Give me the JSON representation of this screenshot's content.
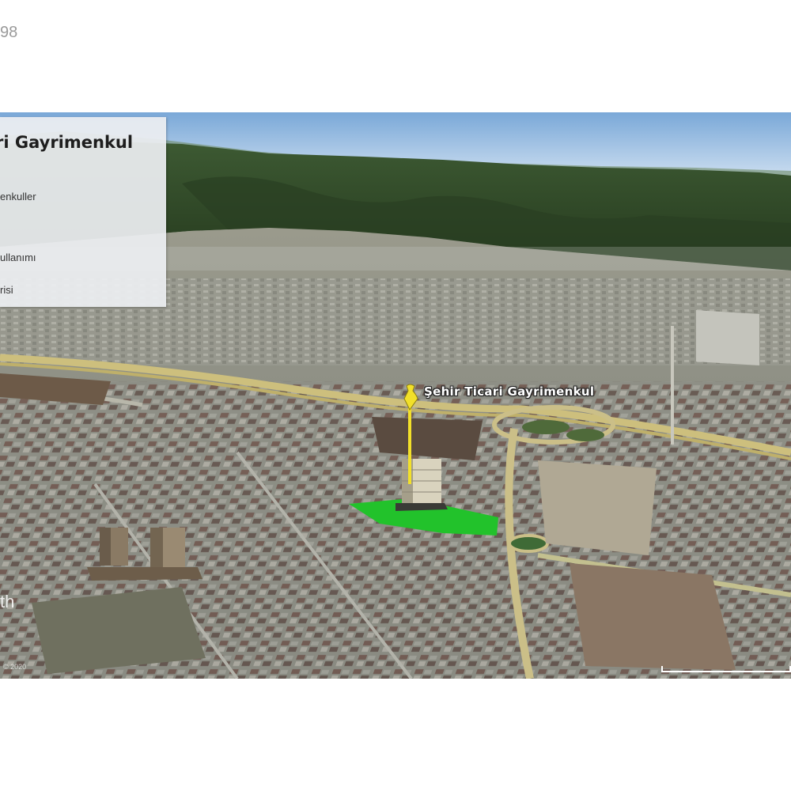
{
  "page": {
    "number": "98"
  },
  "legend": {
    "title": "ri Gayrimenkul",
    "items": [
      "enkuller",
      "ullanımı",
      "risi"
    ]
  },
  "map": {
    "placemark_label": "Şehir Ticari Gayrimenkul",
    "watermark": "th",
    "copyright": "© 2020",
    "colors": {
      "sky": "#a9c8e6",
      "mountain": "#2e4a25",
      "urban": "#8c8e84",
      "highlight_parcel": "#22c22b",
      "pin": "#f2e02a"
    }
  }
}
